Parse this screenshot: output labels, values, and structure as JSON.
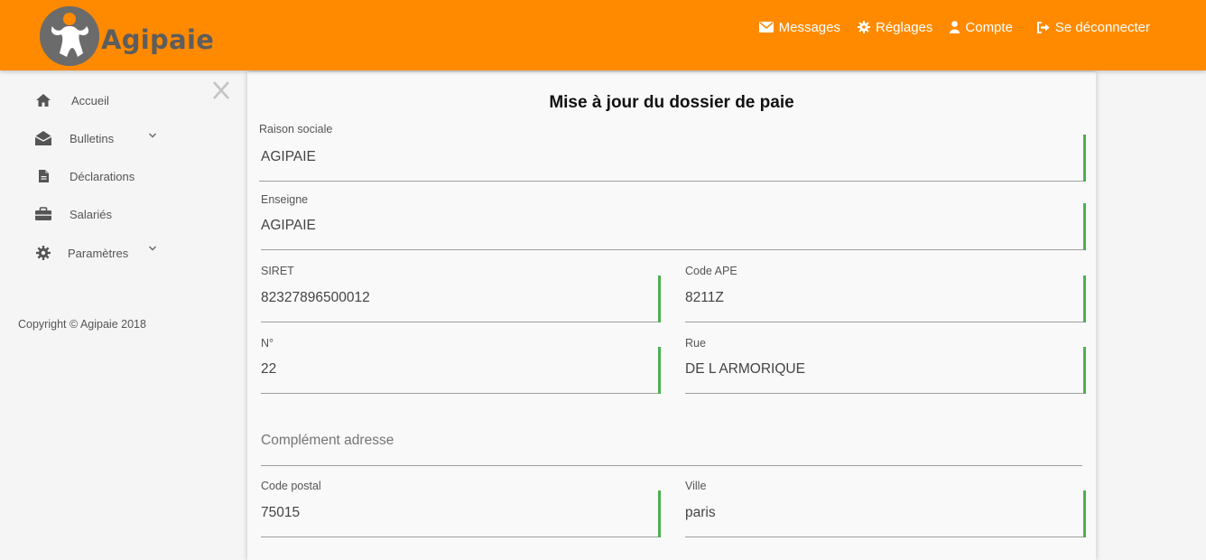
{
  "brand": {
    "name": "Agipaie"
  },
  "topnav": [
    {
      "label": "Messages",
      "icon": "envelope-icon"
    },
    {
      "label": "Réglages",
      "icon": "gear-icon"
    },
    {
      "label": "Compte",
      "icon": "user-icon"
    },
    {
      "label": "Se déconnecter",
      "icon": "sign-out-icon"
    }
  ],
  "sidebar": {
    "items": [
      {
        "label": "Accueil",
        "icon": "home-icon",
        "expandable": false
      },
      {
        "label": "Bulletins",
        "icon": "envelope-open-icon",
        "expandable": true
      },
      {
        "label": "Déclarations",
        "icon": "file-icon",
        "expandable": false
      },
      {
        "label": "Salariés",
        "icon": "briefcase-icon",
        "expandable": false
      },
      {
        "label": "Paramètres",
        "icon": "gear-icon",
        "expandable": true
      }
    ],
    "copyright": "Copyright © Agipaie 2018"
  },
  "form": {
    "title": "Mise à jour du dossier de paie",
    "raison_sociale": {
      "label": "Raison sociale",
      "value": "AGIPAIE"
    },
    "enseigne": {
      "label": "Enseigne",
      "value": "AGIPAIE"
    },
    "siret": {
      "label": "SIRET",
      "value": "82327896500012"
    },
    "code_ape": {
      "label": "Code APE",
      "value": "8211Z"
    },
    "numero": {
      "label": "N°",
      "value": "22"
    },
    "rue": {
      "label": "Rue",
      "value": "DE L ARMORIQUE"
    },
    "complement": {
      "placeholder": "Complément adresse",
      "value": ""
    },
    "code_postal": {
      "label": "Code postal",
      "value": "75015"
    },
    "ville": {
      "label": "Ville",
      "value": "paris"
    }
  },
  "colors": {
    "brand": "#ff8a00",
    "valid": "#4caf50",
    "logo": "#6b6b6b"
  }
}
